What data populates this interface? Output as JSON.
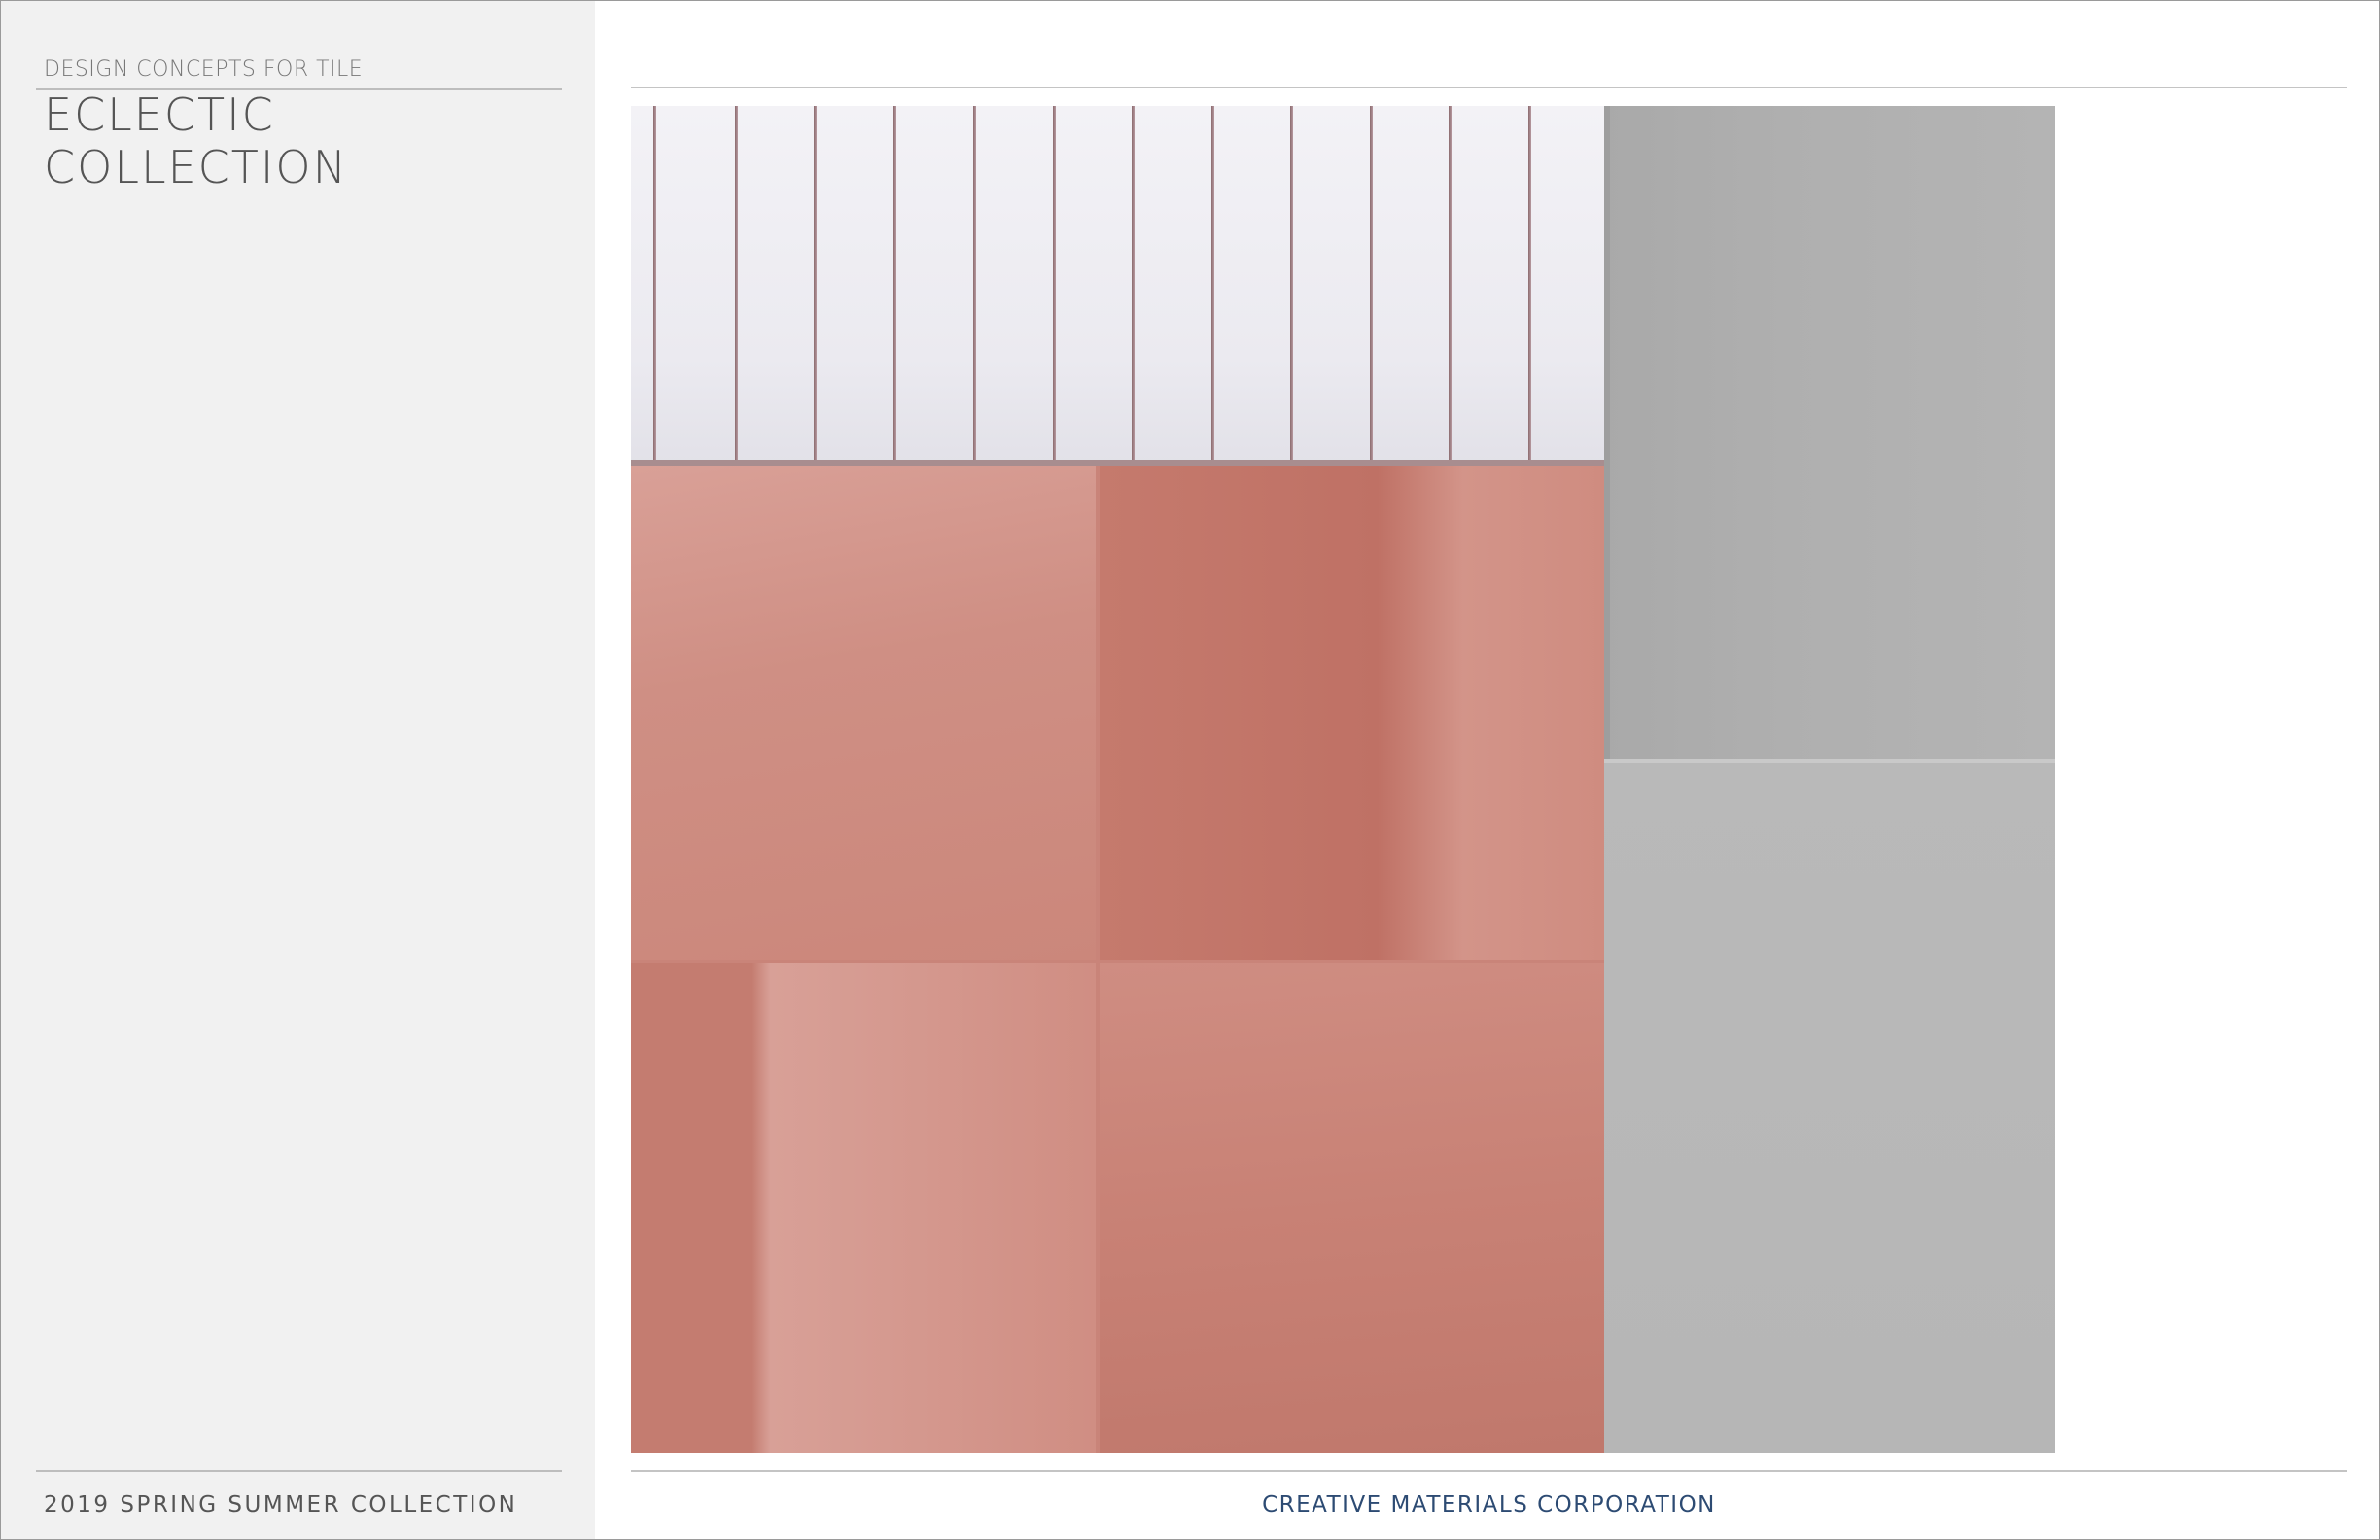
{
  "header": {
    "subtitle": "DESIGN CONCEPTS FOR TILE",
    "title": "ECLECTIC COLLECTION"
  },
  "footer": {
    "season": "2019 SPRING SUMMER COLLECTION",
    "company": "CREATIVE MATERIALS CORPORATION"
  },
  "colors": {
    "left_panel_bg": "#f1f1f1",
    "company_text": "#2d4b73",
    "title_text": "#555555",
    "pink_tile": "#c98479",
    "white_tile": "#eeedf2",
    "grey_tile": "#b0b0b0"
  }
}
